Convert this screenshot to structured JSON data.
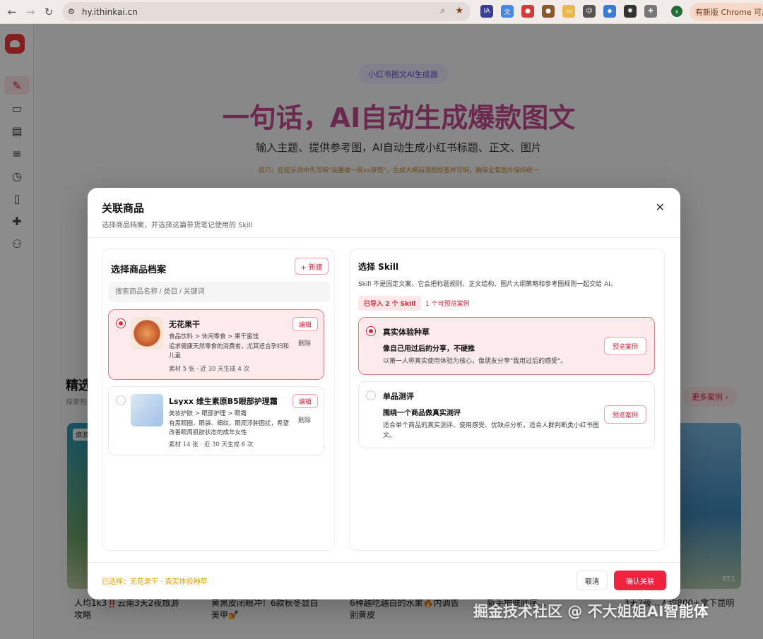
{
  "browser": {
    "url": "hy.ithinkai.cn",
    "update_label": "有新版 Chrome 可用",
    "extensions": [
      "IA",
      "translate",
      "christmas",
      "cookie",
      "folder",
      "robot",
      "shield",
      "openai",
      "puzzle"
    ],
    "avatar_letter": "x"
  },
  "sidebar": {
    "items": [
      "edit-icon",
      "inbox-icon",
      "chat-icon",
      "list-icon",
      "clock-icon",
      "book-icon",
      "puzzle-icon",
      "users-icon"
    ]
  },
  "page": {
    "badge": "小红书图文AI生成器",
    "hero": "一句话，AI自动生成爆款图文",
    "subtitle": "输入主题、提供参考图，AI自动生成小红书标题、正文、图片",
    "tip": "技巧：在提示词中先写明\"我要做一周xx穿搭\"，生成大纲后逐图检查并写明，确保全套图片保持统一",
    "section_title": "精选",
    "section_sub": "探索热",
    "more_cases": "更多案例",
    "cards": [
      {
        "title": "人均1k3‼️云南3天2夜旅游攻略",
        "tag": "旅游"
      },
      {
        "title": "黄黑皮闭眼冲！6款秋冬显白美甲💅",
        "tag": ""
      },
      {
        "title": "6种越吃越白的水果🔥内调告别黄皮",
        "tag": ""
      },
      {
        "title": "新手护肤顺序…",
        "tag": ""
      },
      {
        "title": "3天2夜…人均800+拿下昆明",
        "tag": "851"
      }
    ],
    "watermark": "掘金技术社区 @ 不大姐姐AI智能体"
  },
  "modal": {
    "title": "关联商品",
    "subtitle": "选择商品档案，并选择这篇带货笔记使用的 Skill",
    "left": {
      "title": "选择商品档案",
      "new_label": "+ 新建",
      "search_placeholder": "搜索商品名称 / 类目 / 关键词",
      "products": [
        {
          "name": "无花果干",
          "category": "食品饮料 > 休闲零食 > 果干蜜饯",
          "desc": "追求健康天然零食的消费者，尤其适合孕妇和儿童",
          "meta": "素材 5 张 · 近 30 天生成 4 次",
          "edit": "编辑",
          "delete": "删除"
        },
        {
          "name": "Lsyxx 维生素原B5眼部护理霜",
          "category": "美妆护肤 > 眼部护理 > 眼霜",
          "desc": "有黑眼圈、眼袋、细纹、眼周浮肿困扰，希望改善眼周肌肤状态的成年女性",
          "meta": "素材 14 张 · 近 30 天生成 6 次",
          "edit": "编辑",
          "delete": "删除"
        }
      ]
    },
    "right": {
      "title": "选择 Skill",
      "desc": "Skill 不是固定文案，它会把标题规则、正文结构、图片大纲策略和参考图规则一起交给 AI。",
      "imported": "已导入 2 个 Skill",
      "preview_count": "1 个可预览案例",
      "skills": [
        {
          "name": "真实体验种草",
          "headline": "像自己用过后的分享，不硬推",
          "desc": "以第一人称真实使用体验为核心，像朋友分享\"我用过后的感受\"。",
          "preview": "预览案例"
        },
        {
          "name": "单品测评",
          "headline": "围绕一个商品做真实测评",
          "desc": "适合单个商品的真实测评、使用感受、优缺点分析，适合人群判断类小红书图文。",
          "preview": "预览案例"
        }
      ]
    },
    "footer": {
      "selected": "已选择：无花果干 · 真实体验种草",
      "cancel": "取消",
      "confirm": "确认关联"
    }
  },
  "colors": {
    "accent": "#e3263c",
    "selected_bg": "#fdeaec",
    "warning": "#e3a00b"
  }
}
